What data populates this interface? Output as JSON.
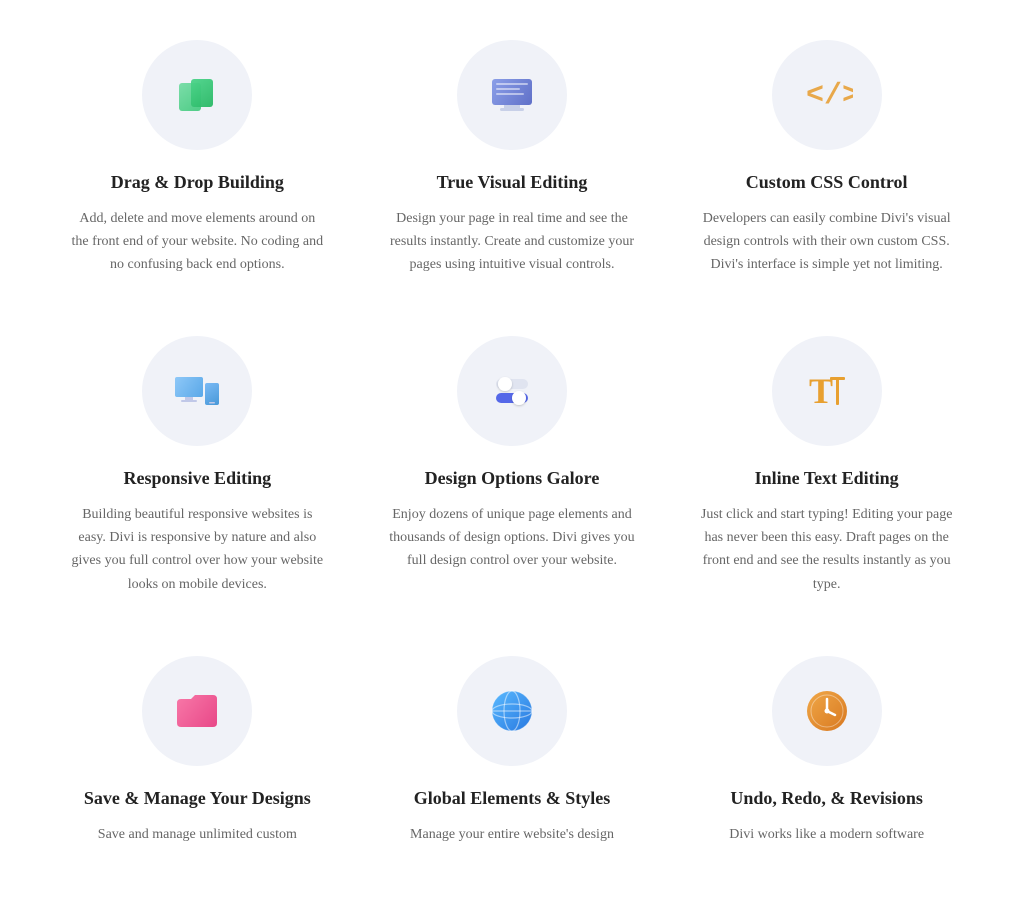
{
  "features": [
    {
      "id": "drag-drop",
      "title": "Drag & Drop Building",
      "desc": "Add, delete and move elements around on the front end of your website. No coding and no confusing back end options.",
      "icon": "drag-drop"
    },
    {
      "id": "true-visual",
      "title": "True Visual Editing",
      "desc": "Design your page in real time and see the results instantly. Create and customize your pages using intuitive visual controls.",
      "icon": "visual-editing"
    },
    {
      "id": "custom-css",
      "title": "Custom CSS Control",
      "desc": "Developers can easily combine Divi's visual design controls with their own custom CSS. Divi's interface is simple yet not limiting.",
      "icon": "custom-css"
    },
    {
      "id": "responsive",
      "title": "Responsive Editing",
      "desc": "Building beautiful responsive websites is easy. Divi is responsive by nature and also gives you full control over how your website looks on mobile devices.",
      "icon": "responsive"
    },
    {
      "id": "design-options",
      "title": "Design Options Galore",
      "desc": "Enjoy dozens of unique page elements and thousands of design options. Divi gives you full design control over your website.",
      "icon": "design-options"
    },
    {
      "id": "inline-text",
      "title": "Inline Text Editing",
      "desc": "Just click and start typing! Editing your page has never been this easy. Draft pages on the front end and see the results instantly as you type.",
      "icon": "inline-text"
    },
    {
      "id": "save-manage",
      "title": "Save & Manage Your Designs",
      "desc": "Save and manage unlimited custom",
      "icon": "save-manage"
    },
    {
      "id": "global-elements",
      "title": "Global Elements & Styles",
      "desc": "Manage your entire website's design",
      "icon": "global-elements"
    },
    {
      "id": "undo-redo",
      "title": "Undo, Redo, & Revisions",
      "desc": "Divi works like a modern software",
      "icon": "undo-redo"
    }
  ]
}
